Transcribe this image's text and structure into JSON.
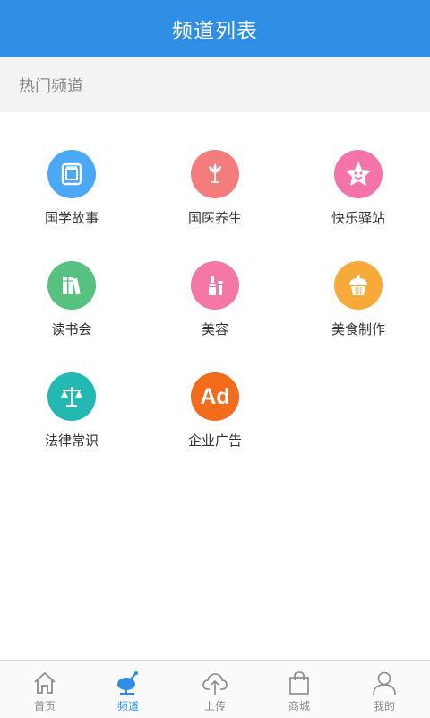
{
  "header": {
    "title": "频道列表"
  },
  "section": {
    "title": "热门频道"
  },
  "channels": [
    {
      "label": "国学故事",
      "icon": "book-icon",
      "color": "#4aa8f5"
    },
    {
      "label": "国医养生",
      "icon": "sprout-icon",
      "color": "#f47c7c"
    },
    {
      "label": "快乐驿站",
      "icon": "star-face-icon",
      "color": "#f473a8"
    },
    {
      "label": "读书会",
      "icon": "books-icon",
      "color": "#57c27f"
    },
    {
      "label": "美容",
      "icon": "lipstick-icon",
      "color": "#f477a6"
    },
    {
      "label": "美食制作",
      "icon": "cupcake-icon",
      "color": "#f7a93a"
    },
    {
      "label": "法律常识",
      "icon": "scales-icon",
      "color": "#24b8b3"
    },
    {
      "label": "企业广告",
      "icon": "ad-icon",
      "color": "#f36c1b",
      "icon_text": "Ad"
    }
  ],
  "tabbar": {
    "items": [
      {
        "label": "首页",
        "icon": "home-icon",
        "active": false
      },
      {
        "label": "频道",
        "icon": "channel-icon",
        "active": true
      },
      {
        "label": "上传",
        "icon": "upload-icon",
        "active": false
      },
      {
        "label": "商城",
        "icon": "shopping-bag-icon",
        "active": false
      },
      {
        "label": "我的",
        "icon": "user-icon",
        "active": false
      }
    ]
  },
  "colors": {
    "accent": "#2f8de4",
    "inactive": "#8a8a8a"
  }
}
